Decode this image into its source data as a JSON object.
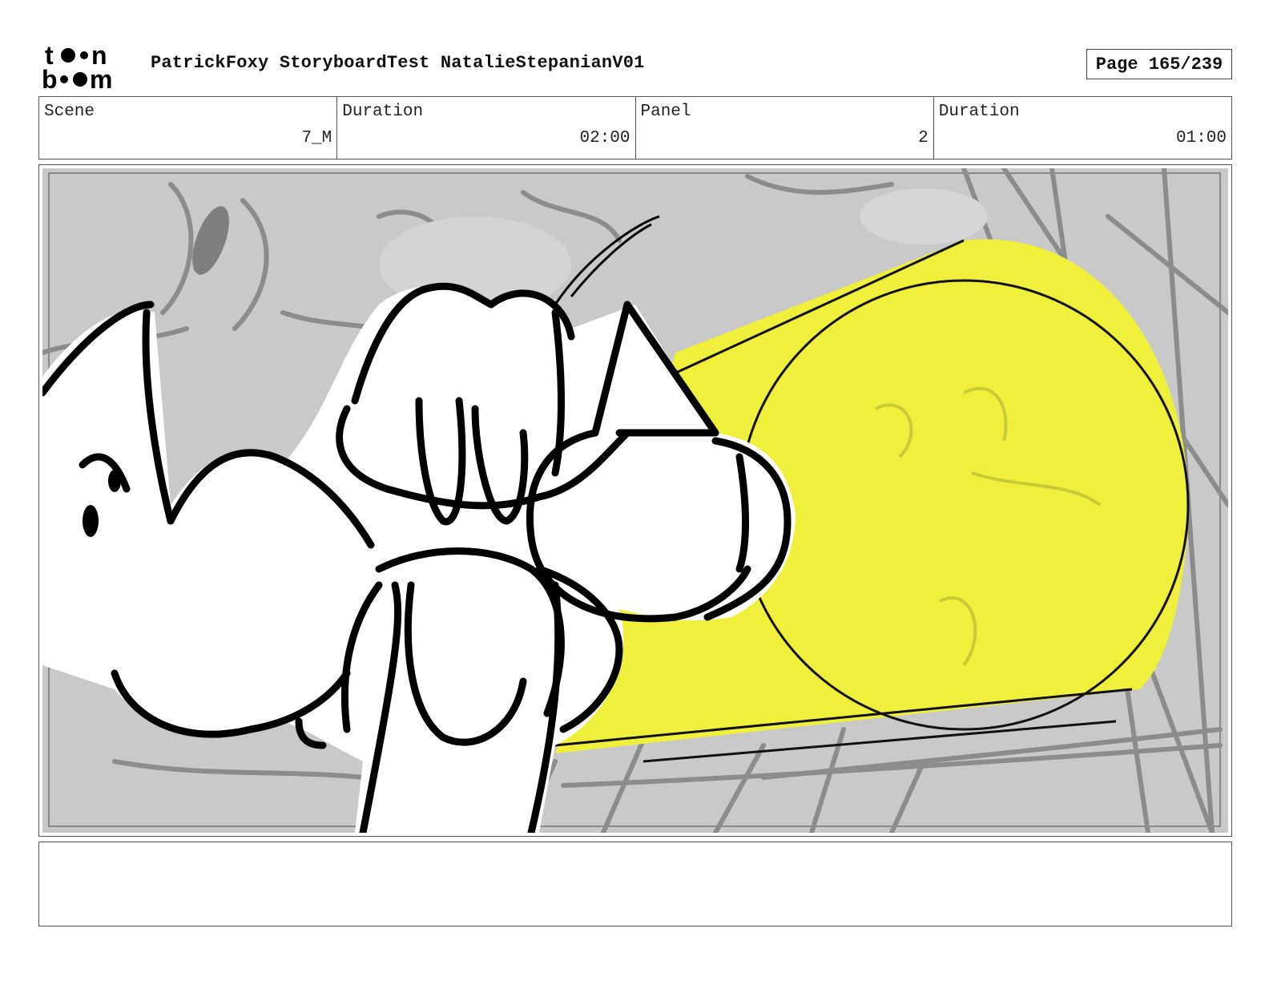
{
  "header": {
    "logo_icon": "toon-boom-logo-icon",
    "title": "PatrickFoxy StoryboardTest NatalieStepanianV01",
    "page": "Page 165/239"
  },
  "info": {
    "scene_label": "Scene",
    "scene_value": "7_M",
    "scene_duration_label": "Duration",
    "scene_duration_value": "02:00",
    "panel_label": "Panel",
    "panel_value": "2",
    "panel_duration_label": "Duration",
    "panel_duration_value": "01:00"
  },
  "panel": {
    "art_icon": "storyboard-sketch-image",
    "colors": {
      "background": "#c8c8c8",
      "highlight": "#eef03c",
      "ink": "#000000"
    }
  },
  "notes": {
    "text": ""
  }
}
